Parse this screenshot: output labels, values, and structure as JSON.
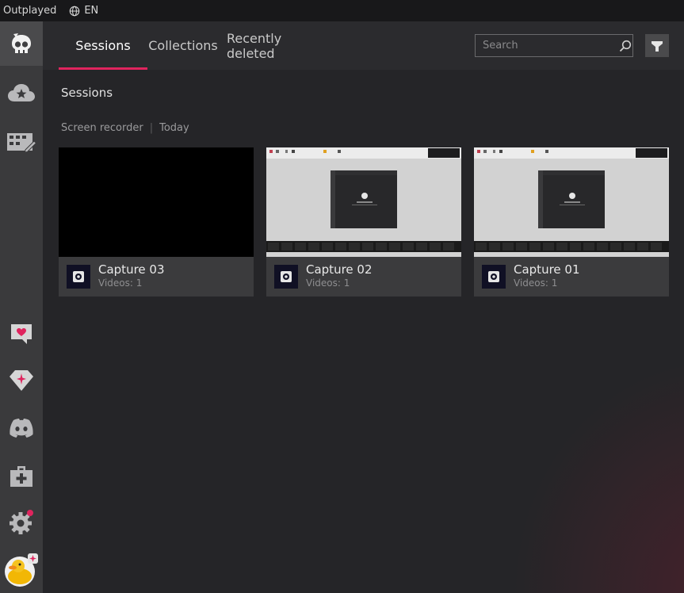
{
  "window": {
    "app_name": "Outplayed",
    "language": "EN"
  },
  "rail": {
    "items": [
      {
        "icon": "skull-logo-icon",
        "active": true
      },
      {
        "icon": "cloud-star-icon"
      },
      {
        "icon": "clapper-edit-icon"
      },
      {
        "icon": "heart-chat-icon"
      },
      {
        "icon": "gem-icon"
      },
      {
        "icon": "discord-icon"
      },
      {
        "icon": "first-aid-kit-icon"
      },
      {
        "icon": "settings-gear-icon",
        "notification": true
      },
      {
        "icon": "duck-avatar-icon"
      }
    ]
  },
  "tabs": [
    {
      "label": "Sessions",
      "active": true
    },
    {
      "label": "Collections"
    },
    {
      "label": "Recently deleted"
    }
  ],
  "search": {
    "placeholder": "Search"
  },
  "section": {
    "title": "Sessions",
    "source": "Screen recorder",
    "date": "Today"
  },
  "cards": [
    {
      "title": "Capture 03",
      "meta": "Videos: 1",
      "thumbnail": "black"
    },
    {
      "title": "Capture 02",
      "meta": "Videos: 1",
      "thumbnail": "screenshot"
    },
    {
      "title": "Capture 01",
      "meta": "Videos: 1",
      "thumbnail": "screenshot"
    }
  ],
  "colors": {
    "accent": "#e0245e",
    "rail_bg": "#3a3a3c",
    "main_bg": "#252528",
    "card_bg": "#3b3b3d"
  }
}
